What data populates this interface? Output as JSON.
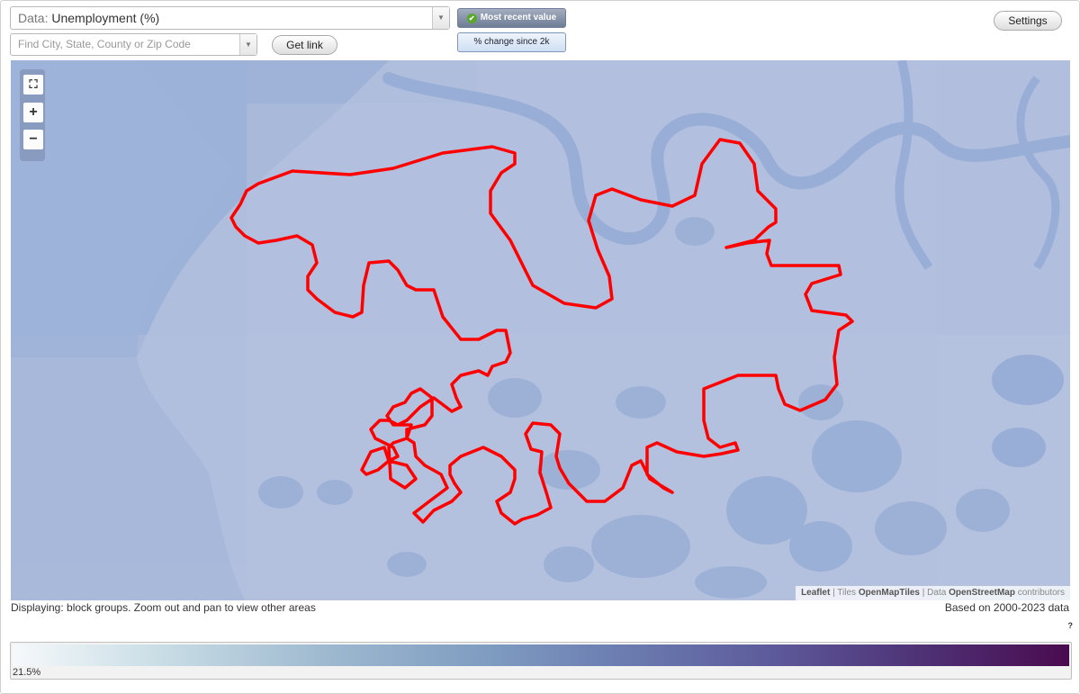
{
  "toolbar": {
    "data_prefix": "Data:",
    "data_value": "Unemployment (%)",
    "search_placeholder": "Find City, State, County or Zip Code",
    "get_link_label": "Get link",
    "toggle_recent_label": "Most recent value",
    "toggle_change_label": "% change since 2k",
    "settings_label": "Settings"
  },
  "map": {
    "zoom_controls": [
      "fit-bounds",
      "zoom-in",
      "zoom-out"
    ],
    "boundary_color": "#ff0000",
    "attribution": {
      "leaflet": "Leaflet",
      "tiles_prefix": "Tiles",
      "tiles_name": "OpenMapTiles",
      "data_prefix": "Data",
      "data_name": "OpenStreetMap",
      "data_suffix": "contributors"
    }
  },
  "status": {
    "displaying": "Displaying: block groups. Zoom out and pan to view other areas",
    "data_range": "Based on 2000-2023 data",
    "help": "?"
  },
  "legend": {
    "min_label": "21.5%",
    "color_low": "#f5f9fb",
    "color_high": "#4a0b4f"
  }
}
